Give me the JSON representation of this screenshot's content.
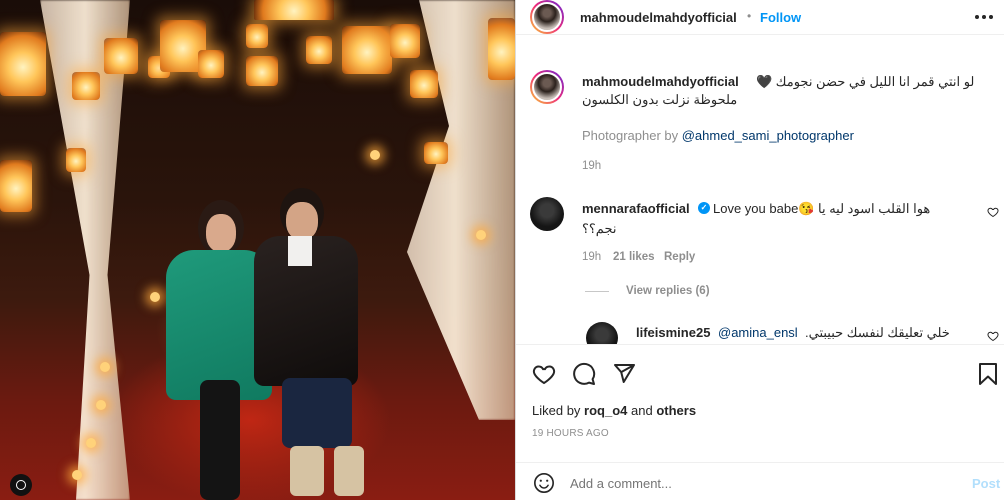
{
  "post": {
    "author": "mahmoudelmahdyofficial",
    "follow_label": "Follow",
    "separator": "•",
    "caption_line1": "لو انتي قمر انا الليل في حضن نجومك 🖤",
    "caption_line2": "ملحوظة نزلت بدون الكلسون",
    "photographer_prefix": "Photographer by ",
    "photographer_handle": "@ahmed_sami_photographer",
    "caption_time": "19h"
  },
  "comments": [
    {
      "user": "mennarafaofficial",
      "verified": true,
      "text_prefix": "Love you babe😘",
      "text_arabic_1": "هوا القلب اسود ليه يا",
      "text_arabic_2": "نجم؟؟",
      "time": "19h",
      "likes": "21 likes",
      "reply_label": "Reply",
      "view_replies": "View replies (6)"
    },
    {
      "user": "lifeismine25",
      "mention": "@amina_ensl",
      "text": "خلي تعليقك لنفسك حبيبتي."
    }
  ],
  "footer": {
    "liked_by_prefix": "Liked by ",
    "liked_by_user": "roq_o4",
    "liked_by_and": " and ",
    "liked_by_others": "others",
    "timestamp": "19 HOURS AGO",
    "comment_placeholder": "Add a comment...",
    "post_label": "Post"
  },
  "icons": {
    "more": "more-options-icon",
    "like": "heart-icon",
    "comment": "comment-icon",
    "share": "share-icon",
    "save": "bookmark-icon",
    "emoji": "emoji-icon"
  },
  "colors": {
    "accent": "#0095f6",
    "muted": "#8e8e8e",
    "text": "#262626"
  }
}
